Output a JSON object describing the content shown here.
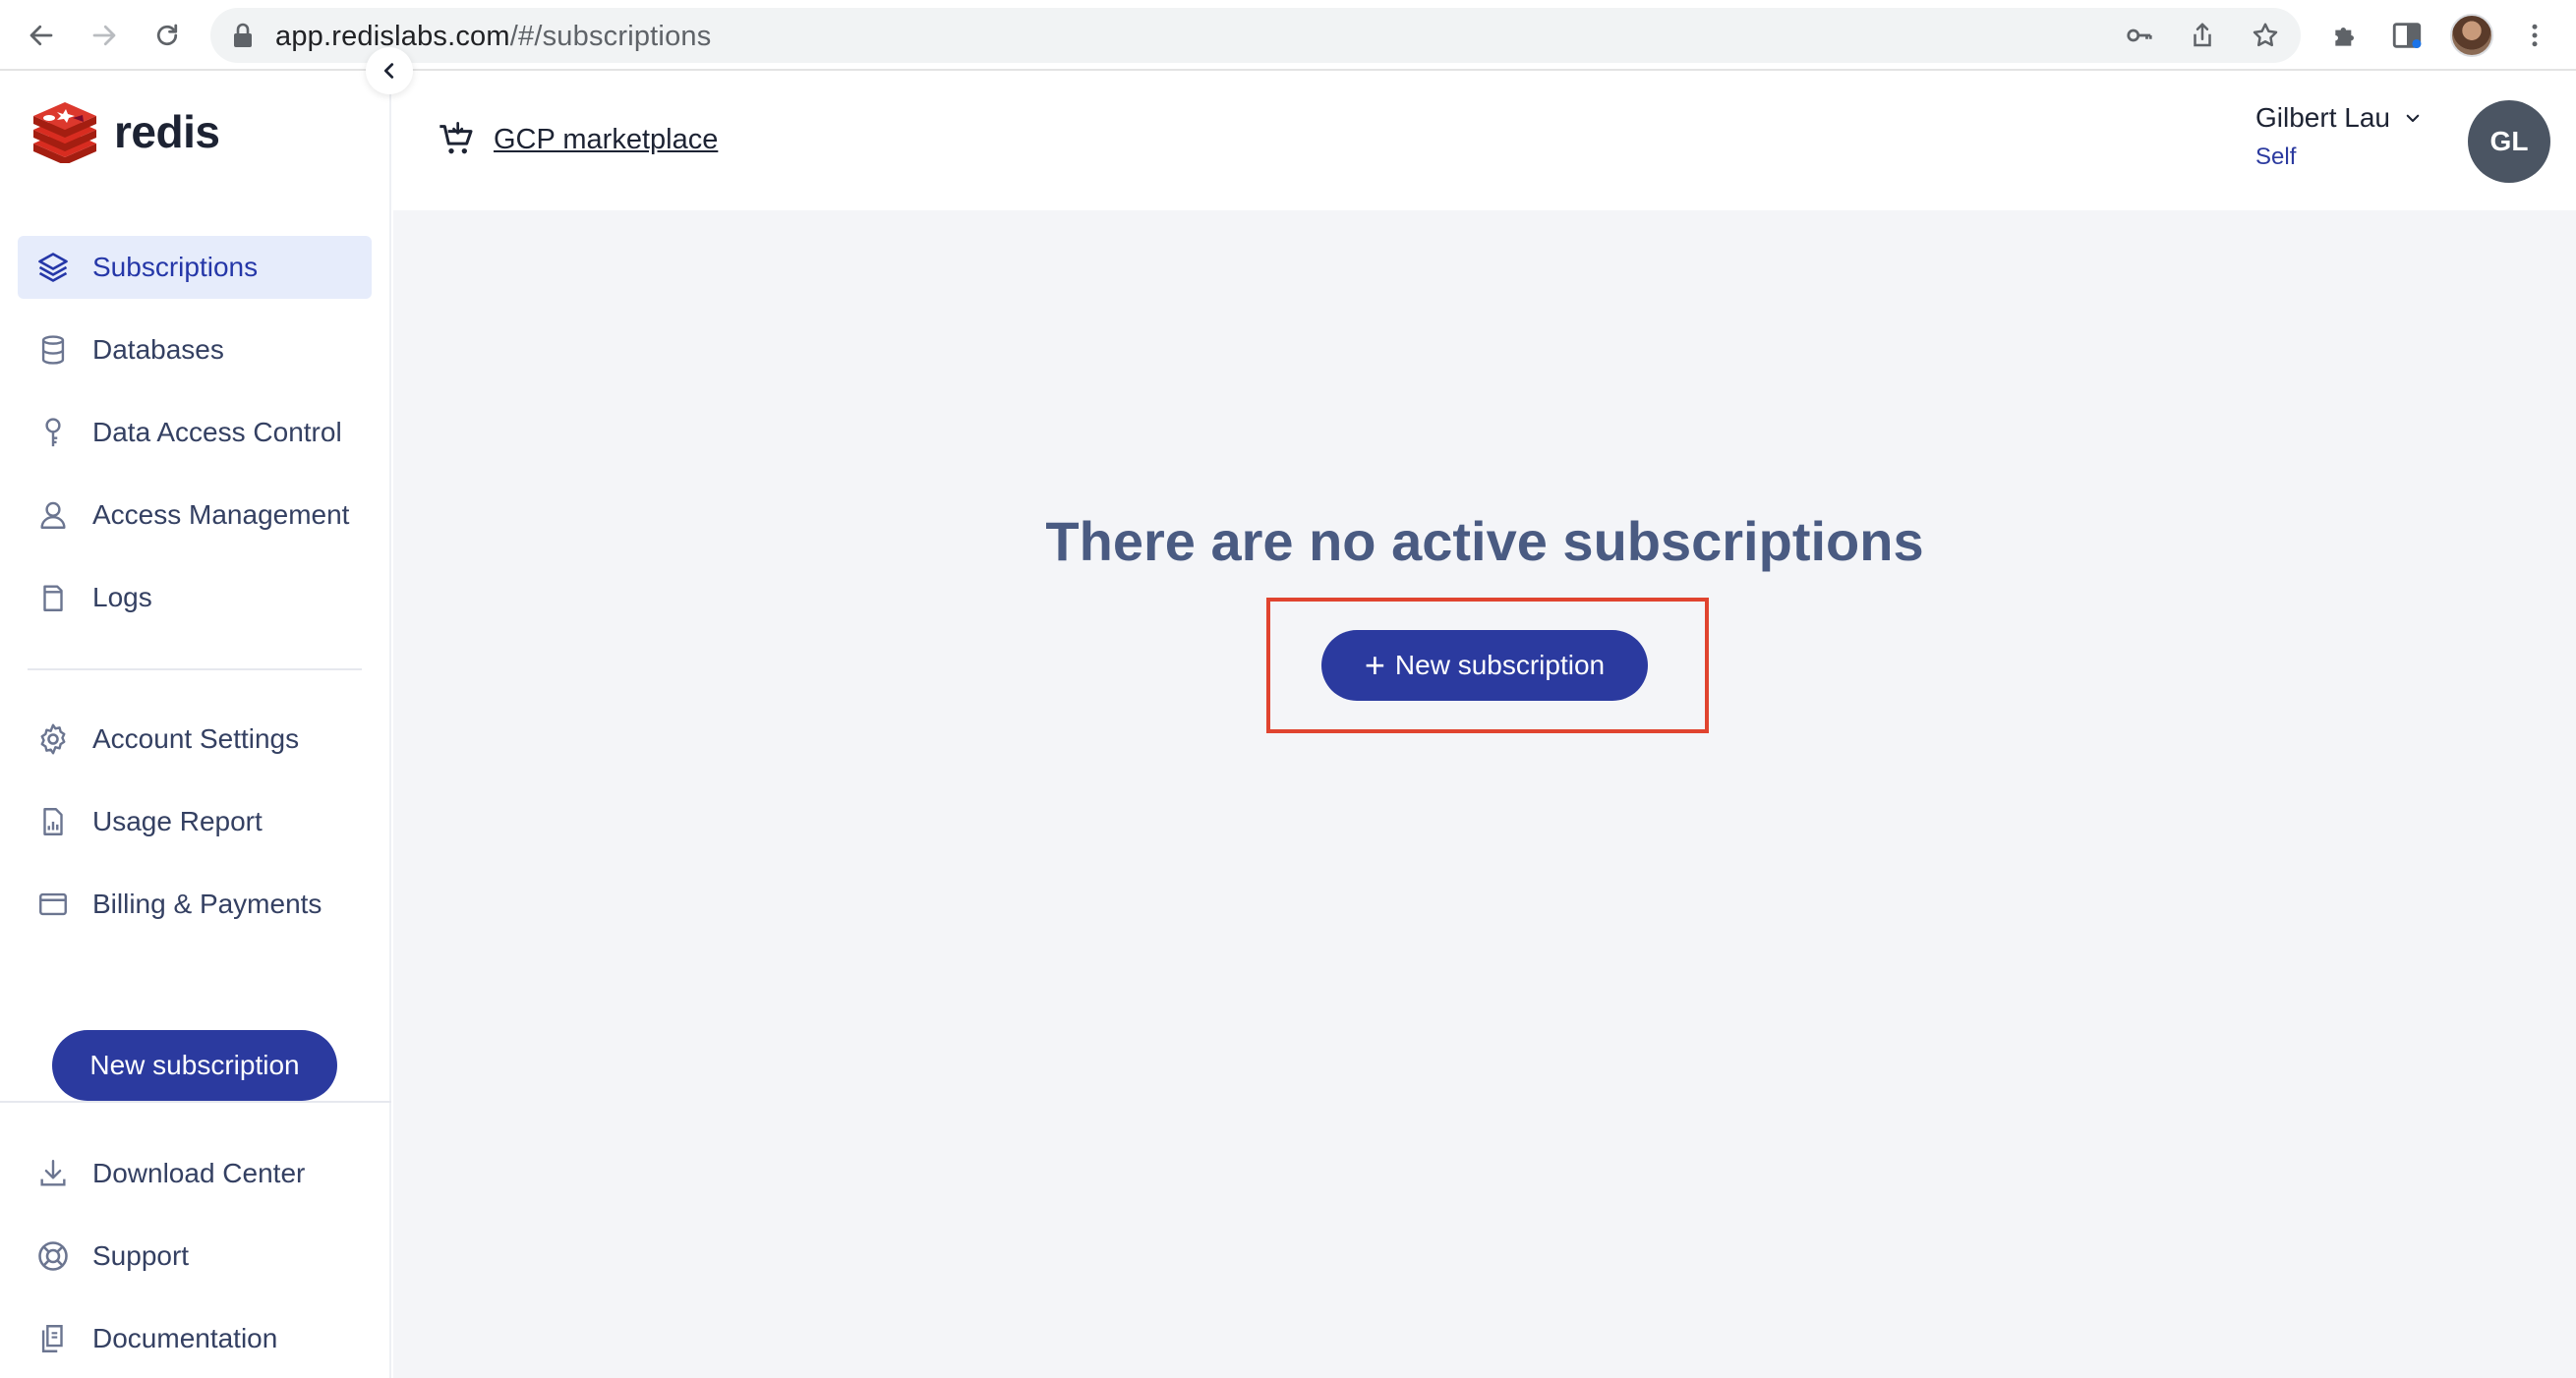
{
  "browser": {
    "url_host": "app.redislabs.com",
    "url_path": "/#/subscriptions"
  },
  "sidebar": {
    "logo_text": "redis",
    "items": [
      {
        "label": "Subscriptions",
        "icon": "layers-icon",
        "active": true
      },
      {
        "label": "Databases",
        "icon": "database-icon"
      },
      {
        "label": "Data Access Control",
        "icon": "key-icon"
      },
      {
        "label": "Access Management",
        "icon": "user-icon"
      },
      {
        "label": "Logs",
        "icon": "document-icon"
      },
      {
        "label": "Account Settings",
        "icon": "gear-icon"
      },
      {
        "label": "Usage Report",
        "icon": "report-icon"
      },
      {
        "label": "Billing & Payments",
        "icon": "credit-card-icon"
      },
      {
        "label": "Download Center",
        "icon": "download-icon"
      },
      {
        "label": "Support",
        "icon": "lifebuoy-icon"
      },
      {
        "label": "Documentation",
        "icon": "docs-icon"
      }
    ],
    "new_subscription_label": "New subscription"
  },
  "header": {
    "marketplace_label": "GCP marketplace",
    "user_name": "Gilbert Lau",
    "user_role": "Self",
    "avatar_initials": "GL"
  },
  "main": {
    "empty_title": "There are no active subscriptions",
    "new_subscription_label": "New subscription",
    "plus": "+"
  },
  "colors": {
    "primary": "#2b3a9f",
    "active_bg": "#e6ecfb",
    "highlight": "#e0442f",
    "main_bg": "#f4f5f8",
    "title": "#4a5b82"
  }
}
